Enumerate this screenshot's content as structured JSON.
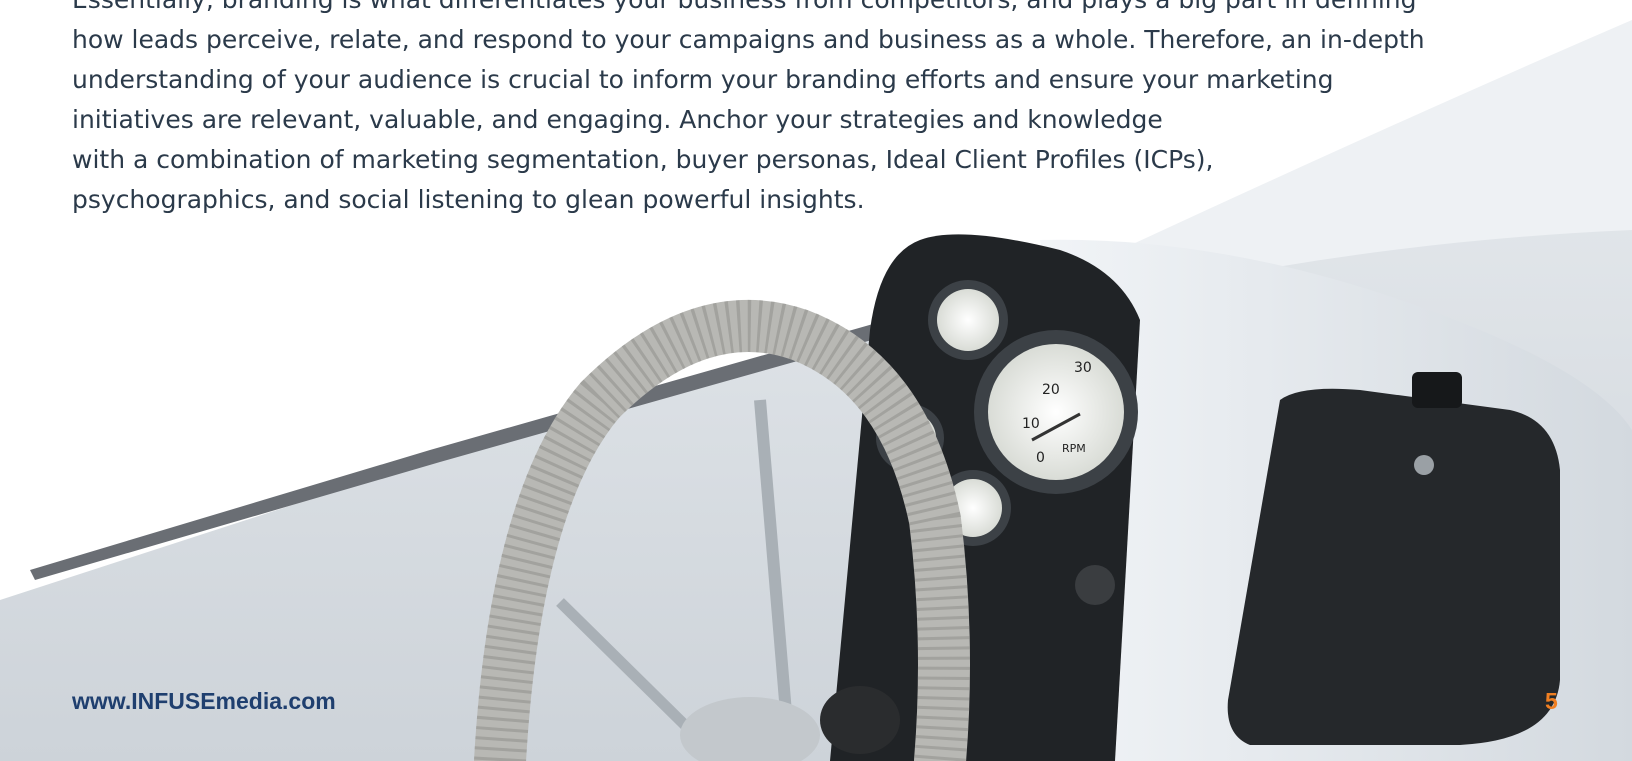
{
  "body": {
    "lines": [
      "Essentially, branding is what differentiates your business from competitors, and plays a big part in defining",
      "how leads perceive, relate, and respond to your campaigns and business as a whole. Therefore, an in-depth",
      "understanding of your audience is crucial to inform your branding efforts and ensure your marketing",
      "initiatives are relevant, valuable, and engaging. Anchor your strategies and knowledge",
      "with a combination of marketing segmentation, buyer personas, Ideal Client Profiles (ICPs),",
      "psychographics, and social listening to glean powerful insights."
    ]
  },
  "photo": {
    "subject": "boat-helm-with-steering-wheel-and-gauges",
    "gauges": {
      "rpm_label": "RPM",
      "rpm_ticks": [
        "0",
        "10",
        "20",
        "30"
      ]
    }
  },
  "footer": {
    "url": "www.INFUSEmedia.com",
    "page_number": "5"
  },
  "colors": {
    "text": "#2b3a4a",
    "footer_url": "#1f3f6f",
    "page_number": "#f07f22"
  }
}
